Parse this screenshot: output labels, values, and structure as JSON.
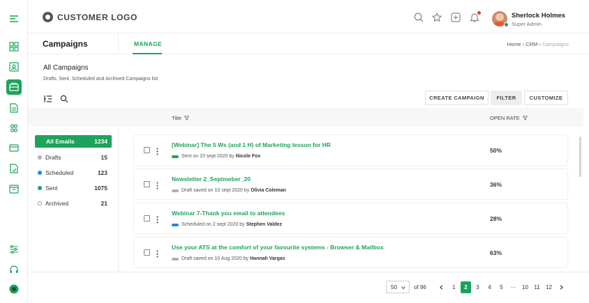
{
  "header": {
    "logo_text": "CUSTOMER LOGO",
    "user_name": "Sherlock Holmes",
    "user_role": "Super Admin"
  },
  "page": {
    "title": "Campaigns",
    "active_tab": "MANAGE",
    "breadcrumb": [
      "Home",
      "CRM",
      "Campaigns"
    ],
    "breadcrumb_sep": "›"
  },
  "section": {
    "title": "All Campaigns",
    "subtitle": "Drafts, Sent, Scheduled and Archived Campaigns list"
  },
  "toolbar": {
    "create_label": "CREATE CAMPAIGN",
    "filter_label": "FILTER",
    "customize_label": "CUSTOMIZE"
  },
  "table": {
    "col_title": "Title",
    "col_open_rate": "OPEN RATE"
  },
  "filters": [
    {
      "label": "All Emails",
      "count": "1234",
      "dot": ""
    },
    {
      "label": "Drafts",
      "count": "15",
      "dot": "#b0b0b0"
    },
    {
      "label": "Scheduled",
      "count": "123",
      "dot": "#1e88e5"
    },
    {
      "label": "Sent",
      "count": "1075",
      "dot": "#1da35b"
    },
    {
      "label": "Archived",
      "count": "21",
      "dot": "outline"
    }
  ],
  "rows": [
    {
      "title": "[Webinar] The 5 Ws (and 1 H) of Marketing lesson for HR",
      "status_prefix": "Sent on 23 sept 2020 by",
      "author": "Nicole Fox",
      "status_color": "#1da35b",
      "open_rate": "50%"
    },
    {
      "title": "Newsletter 2_Septmeber_20",
      "status_prefix": "Draft saved on 10 sept 2020 by",
      "author": "Olivia Coleman",
      "status_color": "#b0b0b0",
      "open_rate": "36%"
    },
    {
      "title": "Webinar 7-Thank you email to attendees",
      "status_prefix": "Scheduled on 2 sept 2020 by",
      "author": "Stephen Valdez",
      "status_color": "#1e88e5",
      "open_rate": "28%"
    },
    {
      "title": "Use your ATS at the comfort of your favourite systems - Browser & Mailbox",
      "status_prefix": "Draft saved on 10 Aug 2020 by",
      "author": "Hannah Vargas",
      "status_color": "#b0b0b0",
      "open_rate": "63%"
    }
  ],
  "pagination": {
    "per_page": "50",
    "of_total": "of 96",
    "pages": [
      "1",
      "2",
      "3",
      "4",
      "5",
      "···",
      "10",
      "11",
      "12"
    ],
    "current": "2"
  },
  "colors": {
    "accent": "#1da35b",
    "blue": "#1e88e5",
    "grey": "#b0b0b0",
    "notification": "#e53935"
  }
}
